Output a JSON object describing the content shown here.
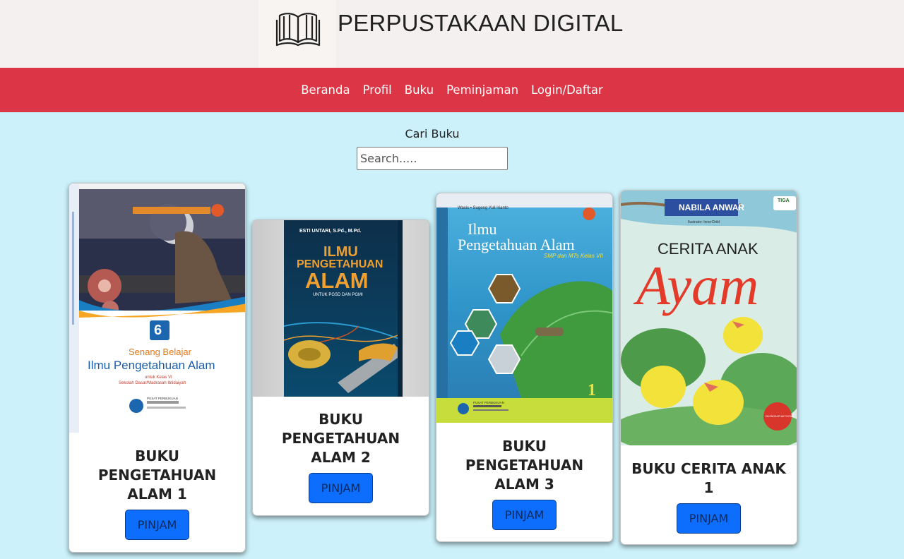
{
  "header": {
    "title": "PERPUSTAKAAN DIGITAL",
    "logo_icon": "open-book-icon"
  },
  "nav": {
    "items": [
      "Beranda",
      "Profil",
      "Buku",
      "Peminjaman",
      "Login/Daftar"
    ]
  },
  "search": {
    "label": "Cari Buku",
    "placeholder": "Search....."
  },
  "books": [
    {
      "title": "BUKU PENGETAHUAN ALAM 1",
      "button": "PINJAM",
      "cover": {
        "grade": "6",
        "line1": "Senang Belajar",
        "line2": "Ilmu Pengetahuan Alam",
        "line3": "untuk Kelas VI",
        "line4": "Sekolah Dasar/Madrasah Ibtidaiyah",
        "publisher": "PUSAT PERBUKUAN"
      }
    },
    {
      "title": "BUKU PENGETAHUAN ALAM 2",
      "button": "PINJAM",
      "cover": {
        "author": "ESTI UNTARI, S.Pd., M.Pd.",
        "line1": "ILMU",
        "line2": "PENGETAHUAN",
        "line3": "ALAM",
        "line4": "UNTUK PGSD DAN PGMI"
      }
    },
    {
      "title": "BUKU PENGETAHUAN ALAM 3",
      "button": "PINJAM",
      "cover": {
        "authors": "Wasis • Sugeng Yuli Irianto",
        "line1": "Ilmu",
        "line2": "Pengetahuan Alam",
        "line3": "SMP dan MTs Kelas VII",
        "volume": "1",
        "publisher": "PUSAT PERBUKUAN"
      }
    },
    {
      "title": "BUKU CERITA ANAK 1",
      "button": "PINJAM",
      "cover": {
        "author": "NABILA ANWAR",
        "publisher": "TIGA",
        "illustrator": "Ilustrator: InnerChild",
        "line1": "CERITA ANAK",
        "line2": "Ayam",
        "badge": "DILENGKAPI AKTIVITAS"
      }
    }
  ],
  "colors": {
    "page_bg": "#ccf1fa",
    "navbar": "#dc3545",
    "button": "#0d6efd",
    "header_bg": "#f3f0ef"
  }
}
